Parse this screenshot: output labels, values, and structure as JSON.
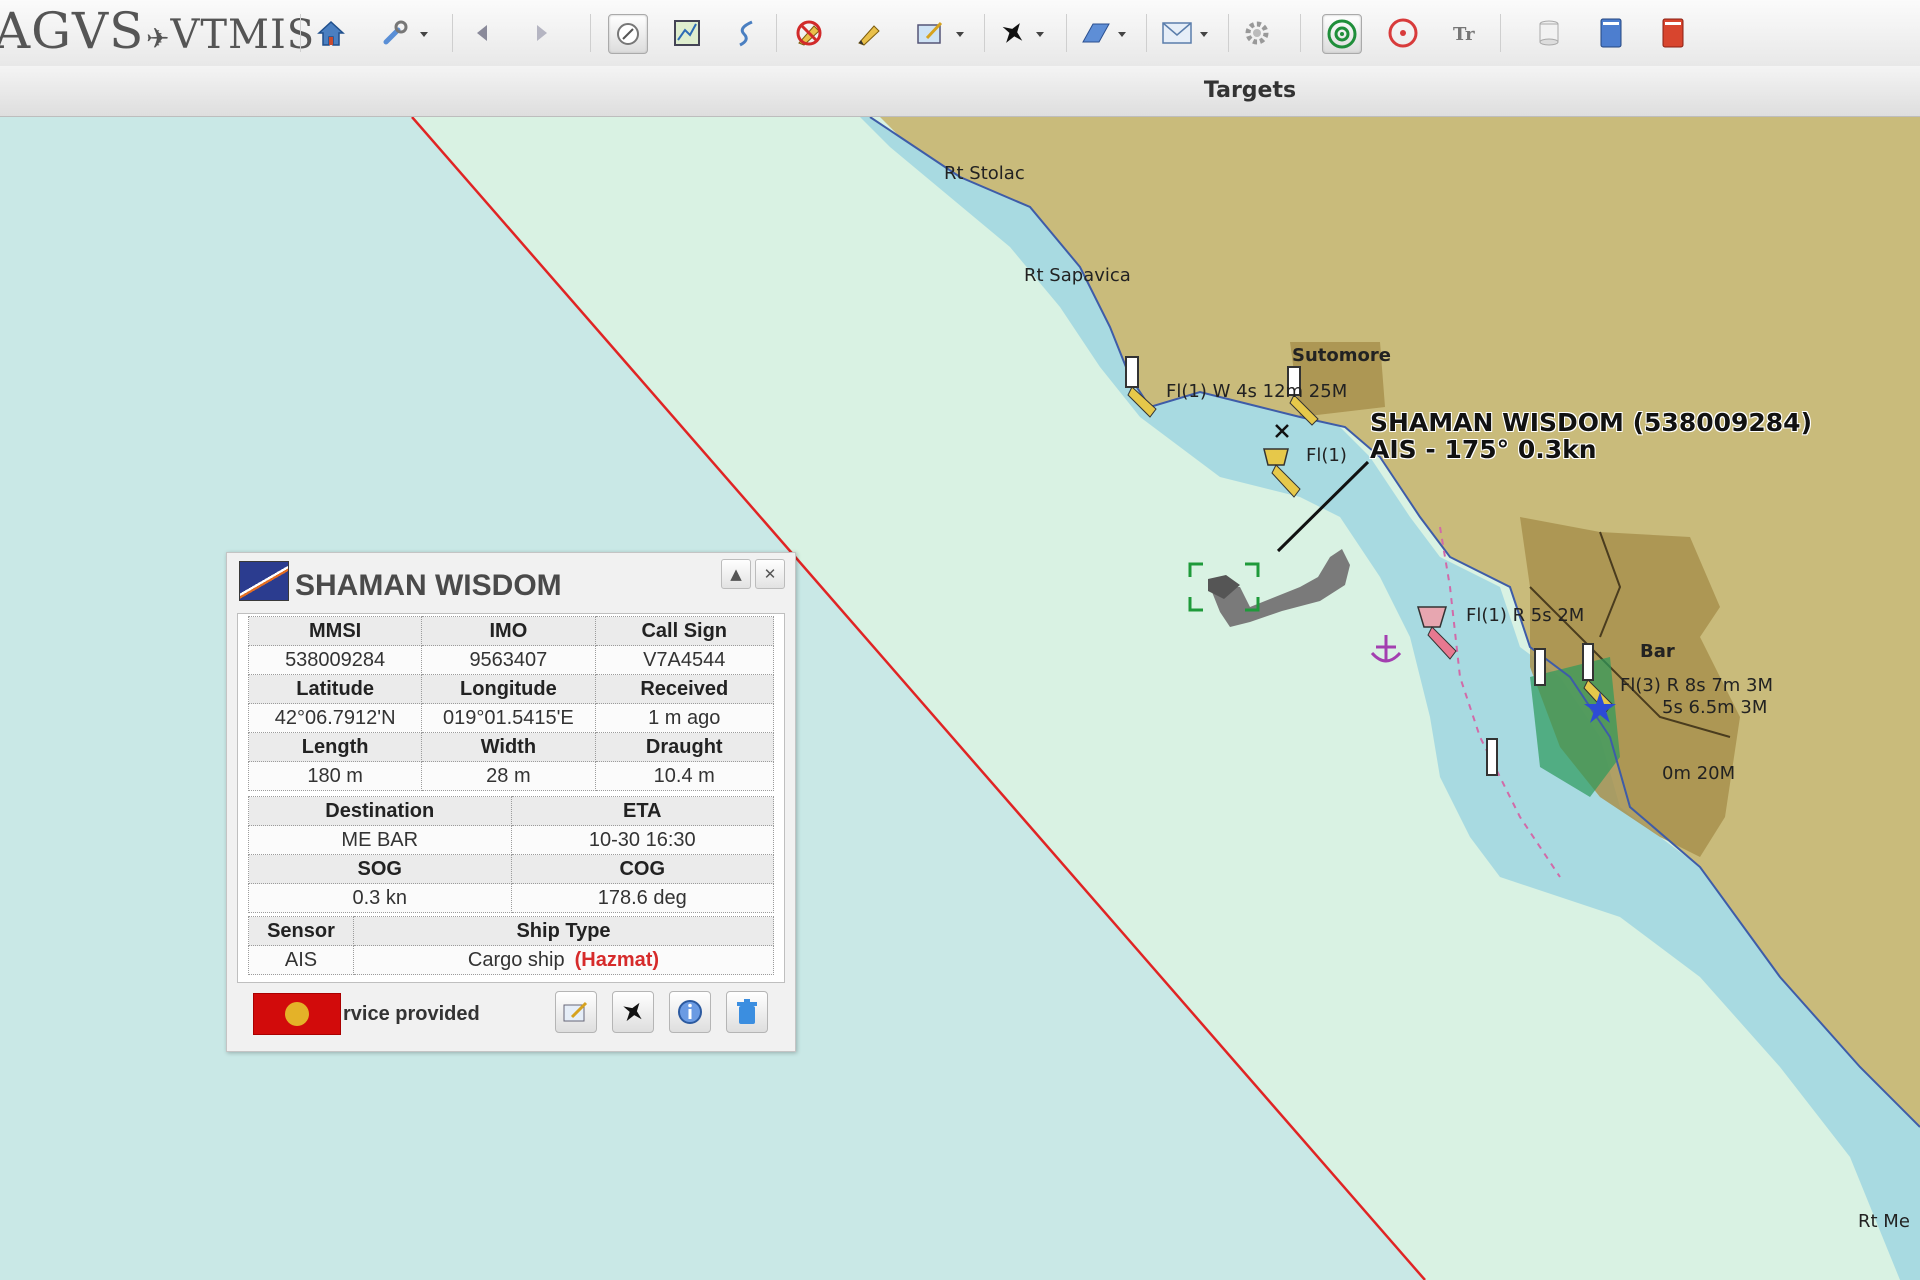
{
  "toolbar": {
    "brand_left": "AGVS",
    "brand_right": "VTMIS",
    "icons": [
      "home-icon",
      "tools-icon",
      "back-arrow-icon",
      "forward-arrow-icon",
      "pen-icon",
      "chart-icon",
      "route-icon",
      "no-edit-icon",
      "edit-icon",
      "target-icon",
      "aircraft-icon",
      "layer-icon",
      "mail-icon",
      "settings-icon",
      "radar-on-icon",
      "radar-off-icon",
      "text-icon",
      "cylinder-icon",
      "blue-book-icon",
      "red-book-icon"
    ]
  },
  "subbar": {
    "title": "Targets"
  },
  "map": {
    "labels": {
      "stolac": "Rt Stolac",
      "sapavica": "Rt Sapavica",
      "sutomore": "Sutomore",
      "light1": "Fl(1) W 4s 12m 25M",
      "light2": "Fl(1)",
      "light3": "Fl(1) R 5s 2M",
      "bar": "Bar",
      "light4": "Fl(3) R 8s 7m 3M",
      "light5": "5s 6.5m 3M",
      "light6": "0m 20M",
      "rtme": "Rt Me"
    },
    "vessel_label_line1": "SHAMAN WISDOM (538009284)",
    "vessel_label_line2": "AIS - 175° 0.3kn",
    "colors": {
      "sea_deep": "#c9e8e6",
      "sea_shallow": "#d9f2e3",
      "land": "#c9bb7b",
      "coast_water": "#9fd6e0",
      "restricted_line": "#e02424"
    }
  },
  "popup": {
    "title": "SHAMAN WISDOM",
    "mmsi_label": "MMSI",
    "imo_label": "IMO",
    "callsign_label": "Call Sign",
    "mmsi": "538009284",
    "imo": "9563407",
    "callsign": "V7A4544",
    "lat_label": "Latitude",
    "lon_label": "Longitude",
    "received_label": "Received",
    "lat": "42°06.7912'N",
    "lon": "019°01.5415'E",
    "received": "1 m ago",
    "length_label": "Length",
    "width_label": "Width",
    "draught_label": "Draught",
    "length": "180 m",
    "width": "28 m",
    "draught": "10.4 m",
    "dest_label": "Destination",
    "eta_label": "ETA",
    "dest": "ME BAR",
    "eta": "10-30 16:30",
    "sog_label": "SOG",
    "cog_label": "COG",
    "sog": "0.3 kn",
    "cog": "178.6 deg",
    "sensor_label": "Sensor",
    "shiptype_label": "Ship Type",
    "sensor": "AIS",
    "shiptype": "Cargo ship",
    "hazmat": "(Hazmat)",
    "footer_text": "rvice provided"
  }
}
